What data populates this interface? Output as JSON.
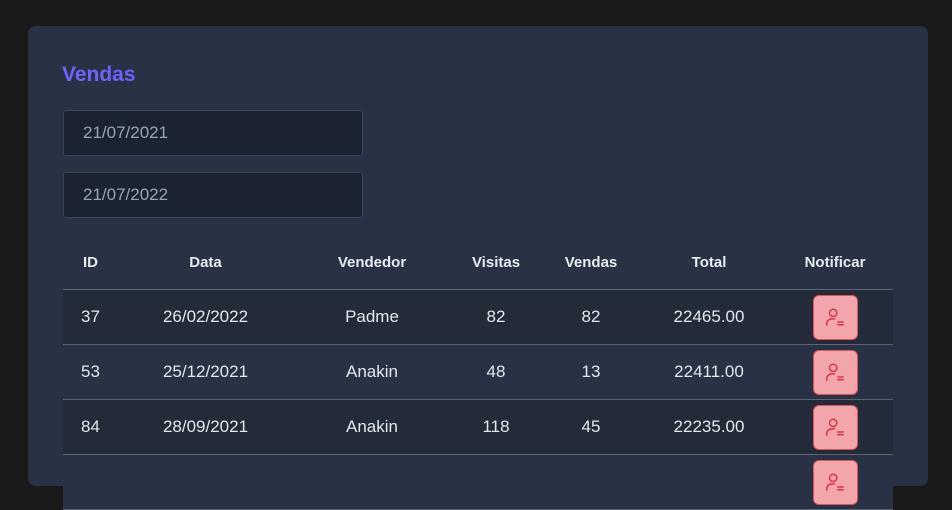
{
  "page": {
    "title": "Vendas"
  },
  "filters": {
    "start_date": "21/07/2021",
    "end_date": "21/07/2022"
  },
  "table": {
    "headers": [
      "ID",
      "Data",
      "Vendedor",
      "Visitas",
      "Vendas",
      "Total",
      "Notificar"
    ],
    "rows": [
      {
        "id": "37",
        "date": "26/02/2022",
        "seller": "Padme",
        "visits": "82",
        "sales": "82",
        "total": "22465.00"
      },
      {
        "id": "53",
        "date": "25/12/2021",
        "seller": "Anakin",
        "visits": "48",
        "sales": "13",
        "total": "22411.00"
      },
      {
        "id": "84",
        "date": "28/09/2021",
        "seller": "Anakin",
        "visits": "118",
        "sales": "45",
        "total": "22235.00"
      },
      {
        "id": "",
        "date": "",
        "seller": "",
        "visits": "",
        "sales": "",
        "total": ""
      }
    ],
    "notify_icon": "user-notify-icon"
  },
  "colors": {
    "title": "#6c63ff",
    "card_background": "#283244",
    "page_background": "#1a1a1a",
    "notify_button_fill": "#f2a6ac",
    "notify_button_border": "#e0505e"
  }
}
